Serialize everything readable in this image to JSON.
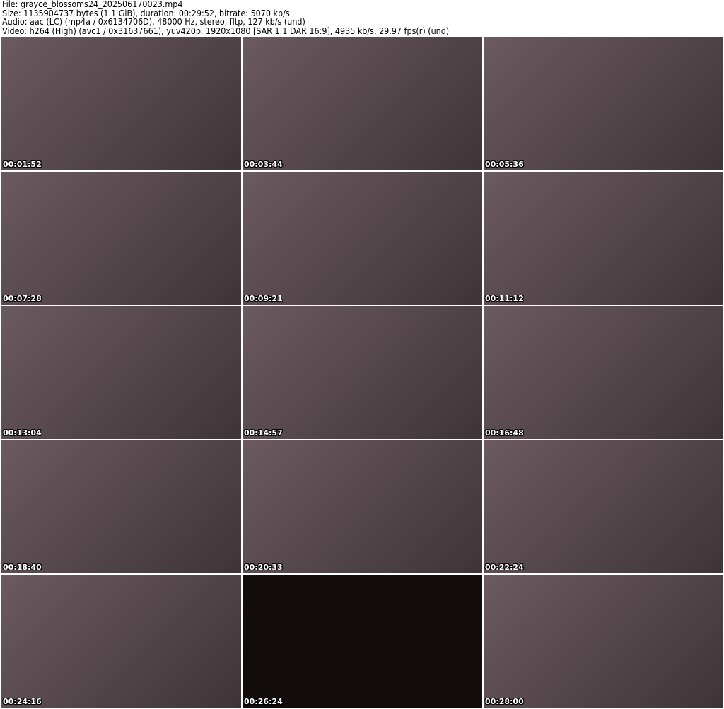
{
  "header": {
    "file": "File: grayce_blossoms24_202506170023.mp4",
    "size": "Size: 1135904737 bytes (1.1 GiB), duration: 00:29:52, bitrate: 5070 kb/s",
    "audio": "Audio: aac (LC) (mp4a / 0x6134706D), 48000 Hz, stereo, fltp, 127 kb/s (und)",
    "video": "Video: h264 (High) (avc1 / 0x31637661), yuv420p, 1920x1080 [SAR 1:1 DAR 16:9], 4935 kb/s, 29.97 fps(r) (und)"
  },
  "thumbnails": [
    {
      "timestamp": "00:01:52"
    },
    {
      "timestamp": "00:03:44"
    },
    {
      "timestamp": "00:05:36"
    },
    {
      "timestamp": "00:07:28"
    },
    {
      "timestamp": "00:09:21"
    },
    {
      "timestamp": "00:11:12"
    },
    {
      "timestamp": "00:13:04"
    },
    {
      "timestamp": "00:14:57"
    },
    {
      "timestamp": "00:16:48"
    },
    {
      "timestamp": "00:18:40"
    },
    {
      "timestamp": "00:20:33"
    },
    {
      "timestamp": "00:22:24"
    },
    {
      "timestamp": "00:24:16"
    },
    {
      "timestamp": "00:26:24"
    },
    {
      "timestamp": "00:28:00"
    }
  ]
}
